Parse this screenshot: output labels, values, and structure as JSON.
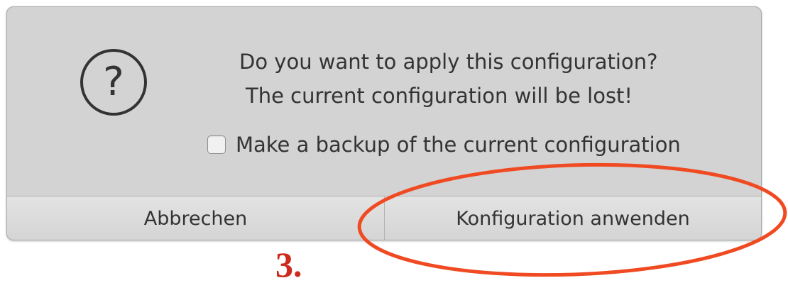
{
  "dialog": {
    "message_line1": "Do you want to apply this configuration?",
    "message_line2": "The current configuration will be lost!",
    "backup_checkbox": {
      "label": "Make a backup of the current configuration",
      "checked": false
    },
    "icon": "question-circle-icon",
    "buttons": {
      "cancel_label": "Abbrechen",
      "apply_label": "Konfiguration anwenden"
    }
  },
  "annotation": {
    "step_label": "3.",
    "highlight_color": "#f04a22",
    "step_color": "#cc2a1c"
  },
  "colors": {
    "dialog_background": "#d3d3d3",
    "text": "#333333"
  }
}
